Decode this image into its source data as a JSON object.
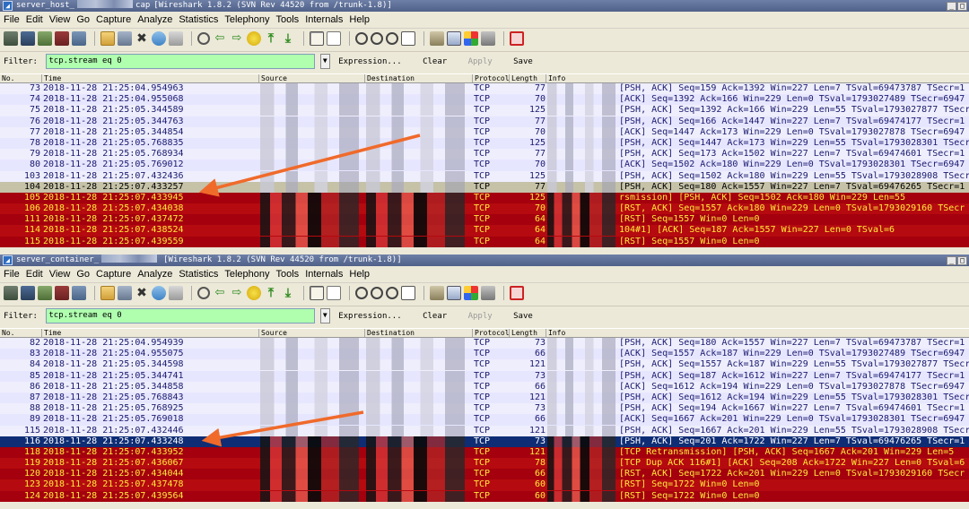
{
  "windows": [
    {
      "title_prefix": "server_host_",
      "title_suffix": "cap",
      "version": "[Wireshark 1.8.2  (SVN Rev 44520 from /trunk-1.8)]",
      "filter": "tcp.stream eq 0",
      "rows": [
        {
          "no": "73",
          "time": "2018-11-28 21:25:04.954963",
          "proto": "TCP",
          "len": "77",
          "info": "[PSH, ACK] Seq=159 Ack=1392 Win=227 Len=7 TSval=69473787 TSecr=1",
          "tone": "normal"
        },
        {
          "no": "74",
          "time": "2018-11-28 21:25:04.955068",
          "proto": "TCP",
          "len": "70",
          "info": "[ACK] Seq=1392 Ack=166 Win=229 Len=0 TSval=1793027489 TSecr=6947",
          "tone": "normal"
        },
        {
          "no": "75",
          "time": "2018-11-28 21:25:05.344589",
          "proto": "TCP",
          "len": "125",
          "info": "[PSH, ACK] Seq=1392 Ack=166 Win=229 Len=55 TSval=1793027877 TSecr",
          "tone": "normal"
        },
        {
          "no": "76",
          "time": "2018-11-28 21:25:05.344763",
          "proto": "TCP",
          "len": "77",
          "info": "[PSH, ACK] Seq=166 Ack=1447 Win=227 Len=7 TSval=69474177 TSecr=1",
          "tone": "normal"
        },
        {
          "no": "77",
          "time": "2018-11-28 21:25:05.344854",
          "proto": "TCP",
          "len": "70",
          "info": "[ACK] Seq=1447 Ack=173 Win=229 Len=0 TSval=1793027878 TSecr=6947",
          "tone": "normal"
        },
        {
          "no": "78",
          "time": "2018-11-28 21:25:05.768835",
          "proto": "TCP",
          "len": "125",
          "info": "[PSH, ACK] Seq=1447 Ack=173 Win=229 Len=55 TSval=1793028301 TSecr",
          "tone": "normal"
        },
        {
          "no": "79",
          "time": "2018-11-28 21:25:05.768934",
          "proto": "TCP",
          "len": "77",
          "info": "[PSH, ACK] Seq=173 Ack=1502 Win=227 Len=7 TSval=69474601 TSecr=1",
          "tone": "normal"
        },
        {
          "no": "80",
          "time": "2018-11-28 21:25:05.769012",
          "proto": "TCP",
          "len": "70",
          "info": "[ACK] Seq=1502 Ack=180 Win=229 Len=0 TSval=1793028301 TSecr=6947",
          "tone": "normal"
        },
        {
          "no": "103",
          "time": "2018-11-28 21:25:07.432436",
          "proto": "TCP",
          "len": "125",
          "info": "[PSH, ACK] Seq=1502 Ack=180 Win=229 Len=55 TSval=1793028908 TSecr",
          "tone": "normal"
        },
        {
          "no": "104",
          "time": "2018-11-28 21:25:07.433257",
          "proto": "TCP",
          "len": "77",
          "info": "[PSH, ACK] Seq=180 Ack=1557 Win=227 Len=7 TSval=69476265 TSecr=1",
          "tone": "sel"
        },
        {
          "no": "105",
          "time": "2018-11-28 21:25:07.433945",
          "proto": "TCP",
          "len": "125",
          "info": "rsmission]             [PSH, ACK] Seq=1502 Ack=180 Win=229 Len=55",
          "tone": "err"
        },
        {
          "no": "106",
          "time": "2018-11-28 21:25:07.434038",
          "proto": "TCP",
          "len": "70",
          "info": "[RST, ACK] Seq=1557 Ack=180 Win=229 Len=0 TSval=1793029160 TSecr",
          "tone": "err2"
        },
        {
          "no": "111",
          "time": "2018-11-28 21:25:07.437472",
          "proto": "TCP",
          "len": "64",
          "info": "[RST] Seq=1557 Win=0 Len=0",
          "tone": "err"
        },
        {
          "no": "114",
          "time": "2018-11-28 21:25:07.438524",
          "proto": "TCP",
          "len": "64",
          "info": "104#1]            [ACK] Seq=187 Ack=1557 Win=227 Len=0 TSval=6",
          "tone": "err2"
        },
        {
          "no": "115",
          "time": "2018-11-28 21:25:07.439559",
          "proto": "TCP",
          "len": "64",
          "info": "[RST] Seq=1557 Win=0 Len=0",
          "tone": "err"
        }
      ]
    },
    {
      "title_prefix": "server_container_",
      "title_suffix": "",
      "version": "[Wireshark 1.8.2  (SVN Rev 44520 from /trunk-1.8)]",
      "filter": "tcp.stream eq 0",
      "rows": [
        {
          "no": "82",
          "time": "2018-11-28 21:25:04.954939",
          "proto": "TCP",
          "len": "73",
          "info": "[PSH, ACK] Seq=180 Ack=1557 Win=227 Len=7 TSval=69473787 TSecr=1",
          "tone": "normal"
        },
        {
          "no": "83",
          "time": "2018-11-28 21:25:04.955075",
          "proto": "TCP",
          "len": "66",
          "info": "[ACK] Seq=1557 Ack=187 Win=229 Len=0 TSval=1793027489 TSecr=6947",
          "tone": "normal"
        },
        {
          "no": "84",
          "time": "2018-11-28 21:25:05.344598",
          "proto": "TCP",
          "len": "121",
          "info": "[PSH, ACK] Seq=1557 Ack=187 Win=229 Len=55 TSval=1793027877 TSecr",
          "tone": "normal"
        },
        {
          "no": "85",
          "time": "2018-11-28 21:25:05.344741",
          "proto": "TCP",
          "len": "73",
          "info": "[PSH, ACK] Seq=187 Ack=1612 Win=227 Len=7 TSval=69474177 TSecr=1",
          "tone": "normal"
        },
        {
          "no": "86",
          "time": "2018-11-28 21:25:05.344858",
          "proto": "TCP",
          "len": "66",
          "info": "[ACK] Seq=1612 Ack=194 Win=229 Len=0 TSval=1793027878 TSecr=6947",
          "tone": "normal"
        },
        {
          "no": "87",
          "time": "2018-11-28 21:25:05.768843",
          "proto": "TCP",
          "len": "121",
          "info": "[PSH, ACK] Seq=1612 Ack=194 Win=229 Len=55 TSval=1793028301 TSecr",
          "tone": "normal"
        },
        {
          "no": "88",
          "time": "2018-11-28 21:25:05.768925",
          "proto": "TCP",
          "len": "73",
          "info": "[PSH, ACK] Seq=194 Ack=1667 Win=227 Len=7 TSval=69474601 TSecr=1",
          "tone": "normal"
        },
        {
          "no": "89",
          "time": "2018-11-28 21:25:05.769018",
          "proto": "TCP",
          "len": "66",
          "info": "[ACK] Seq=1667 Ack=201 Win=229 Len=0 TSval=1793028301 TSecr=6947",
          "tone": "normal"
        },
        {
          "no": "115",
          "time": "2018-11-28 21:25:07.432446",
          "proto": "TCP",
          "len": "121",
          "info": "[PSH, ACK] Seq=1667 Ack=201 Win=229 Len=55 TSval=1793028908 TSecr",
          "tone": "normal"
        },
        {
          "no": "116",
          "time": "2018-11-28 21:25:07.433248",
          "proto": "TCP",
          "len": "73",
          "info": "[PSH, ACK] Seq=201 Ack=1722 Win=227 Len=7 TSval=69476265 TSecr=1",
          "tone": "sel2"
        },
        {
          "no": "118",
          "time": "2018-11-28 21:25:07.433952",
          "proto": "TCP",
          "len": "121",
          "info": "[TCP Retransmission]        [PSH, ACK] Seq=1667 Ack=201 Win=229 Len=5",
          "tone": "err"
        },
        {
          "no": "119",
          "time": "2018-11-28 21:25:07.436067",
          "proto": "TCP",
          "len": "78",
          "info": "[TCP Dup ACK 116#1]            [ACK] Seq=208 Ack=1722 Win=227 Len=0 TSval=6",
          "tone": "err2"
        },
        {
          "no": "120",
          "time": "2018-11-28 21:25:07.434044",
          "proto": "TCP",
          "len": "66",
          "info": "[RST, ACK] Seq=1722 Ack=201 Win=229 Len=0 TSval=1793029160 TSecr",
          "tone": "err"
        },
        {
          "no": "123",
          "time": "2018-11-28 21:25:07.437478",
          "proto": "TCP",
          "len": "60",
          "info": "[RST] Seq=1722 Win=0 Len=0",
          "tone": "err2"
        },
        {
          "no": "124",
          "time": "2018-11-28 21:25:07.439564",
          "proto": "TCP",
          "len": "60",
          "info": "[RST] Seq=1722 Win=0 Len=0",
          "tone": "err"
        }
      ]
    }
  ],
  "menu": [
    "File",
    "Edit",
    "View",
    "Go",
    "Capture",
    "Analyze",
    "Statistics",
    "Telephony",
    "Tools",
    "Internals",
    "Help"
  ],
  "filterbar": {
    "label": "Filter:",
    "expression": "Expression...",
    "clear": "Clear",
    "apply": "Apply",
    "save": "Save"
  },
  "columns": [
    "No.",
    "Time",
    "Source",
    "Destination",
    "Protocol",
    "Length",
    "Info"
  ],
  "toolbar_icons": [
    "interfaces-icon",
    "capture-options-icon",
    "start-capture-icon",
    "stop-capture-icon",
    "restart-capture-icon",
    "open-icon",
    "save-icon",
    "close-file-icon",
    "reload-icon",
    "print-icon",
    "find-icon",
    "back-icon",
    "forward-icon",
    "go-to-packet-icon",
    "first-packet-icon",
    "last-packet-icon",
    "colorize-icon",
    "autoscroll-icon",
    "zoom-in-icon",
    "zoom-out-icon",
    "normal-size-icon",
    "resize-columns-icon",
    "capture-filters-icon",
    "display-filters-icon",
    "coloring-rules-icon",
    "preferences-icon",
    "help-icon"
  ],
  "colors": {
    "normal_row": "#e7e6ff",
    "selected_row_top": "#c5c2a8",
    "selected_row_bottom": "#0e2d74",
    "error_row": "#a4000e",
    "filter_valid": "#afffaf",
    "arrow": "#f06a2a"
  }
}
